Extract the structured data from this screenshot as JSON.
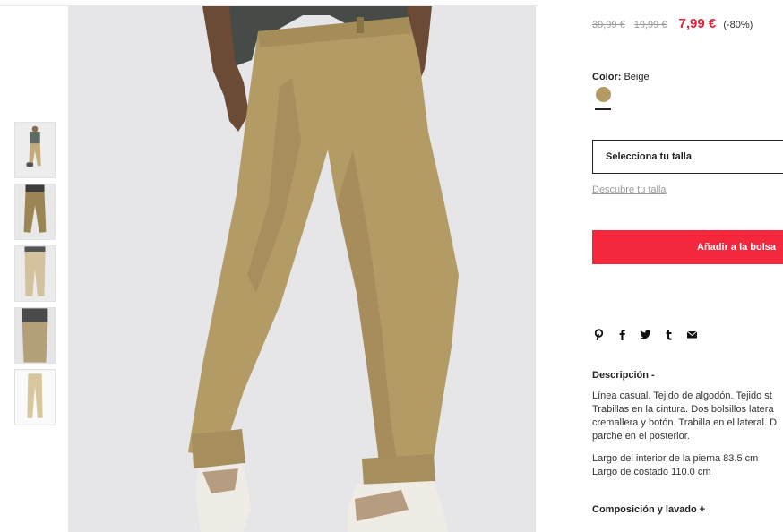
{
  "product": {
    "prices": {
      "original": "39,99 €",
      "previous": "19,99 €",
      "current": "7,99 €",
      "discount": "(-80%)"
    },
    "color": {
      "label": "Color:",
      "value": "Beige",
      "swatch_hex": "#b49b65"
    },
    "size_select_label": "Selecciona tu talla",
    "size_guide_link": "Descubre tu talla",
    "add_to_bag_label": "Añadir a la bolsa",
    "social_icons": [
      "pinterest-icon",
      "facebook-icon",
      "twitter-icon",
      "tumblr-icon",
      "email-icon"
    ],
    "description": {
      "title": "Descripción -",
      "lines": [
        "Línea casual. Tejido de algodón. Tejido st",
        "Trabillas en la cintura. Dos bolsillos latera",
        "cremallera y botón. Trabilla en el lateral. D",
        "parche en el posterior."
      ],
      "measures": [
        "Largo del interior de la pierna 83.5 cm",
        "Largo de costado 110.0 cm"
      ]
    },
    "composition_title": "Composición y lavado +"
  },
  "colors": {
    "sale_red": "#e8213b",
    "button_red": "#f4273c",
    "pants_beige": "#b49b65"
  }
}
